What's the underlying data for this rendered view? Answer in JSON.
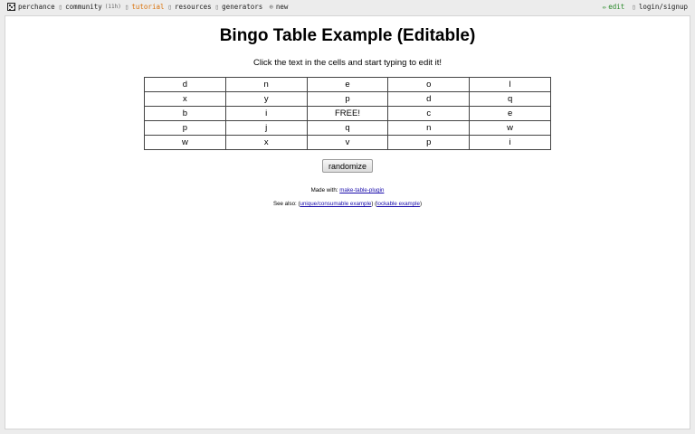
{
  "nav": {
    "brand": "perchance",
    "community": "community",
    "community_count": "(11h)",
    "tutorial": "tutorial",
    "resources": "resources",
    "generators": "generators",
    "new": "new",
    "edit": "edit",
    "login": "login/signup",
    "icons": {
      "brand": "die-icon",
      "community": "chat-icon",
      "tutorial": "book-icon",
      "resources": "folder-icon",
      "generators": "grid-icon",
      "new": "plus-circle-icon",
      "edit": "pencil-icon",
      "login": "user-icon"
    }
  },
  "page": {
    "title": "Bingo Table Example (Editable)",
    "subtitle": "Click the text in the cells and start typing to edit it!",
    "randomize_label": "randomize",
    "made_with_prefix": "Made with: ",
    "made_with_link": "make-table-plugin",
    "see_also_prefix": "See also: (",
    "see_also_link1": "unique/consumable example",
    "see_also_mid": ") (",
    "see_also_link2": "lockable example",
    "see_also_suffix": ")"
  },
  "table": {
    "rows": [
      [
        "d",
        "n",
        "e",
        "o",
        "l"
      ],
      [
        "x",
        "y",
        "p",
        "d",
        "q"
      ],
      [
        "b",
        "i",
        "FREE!",
        "c",
        "e"
      ],
      [
        "p",
        "j",
        "q",
        "n",
        "w"
      ],
      [
        "w",
        "x",
        "v",
        "p",
        "i"
      ]
    ]
  },
  "colors": {
    "tutorial": "#d9730d",
    "edit": "#2a8a2a",
    "link": "#1a0dab"
  }
}
